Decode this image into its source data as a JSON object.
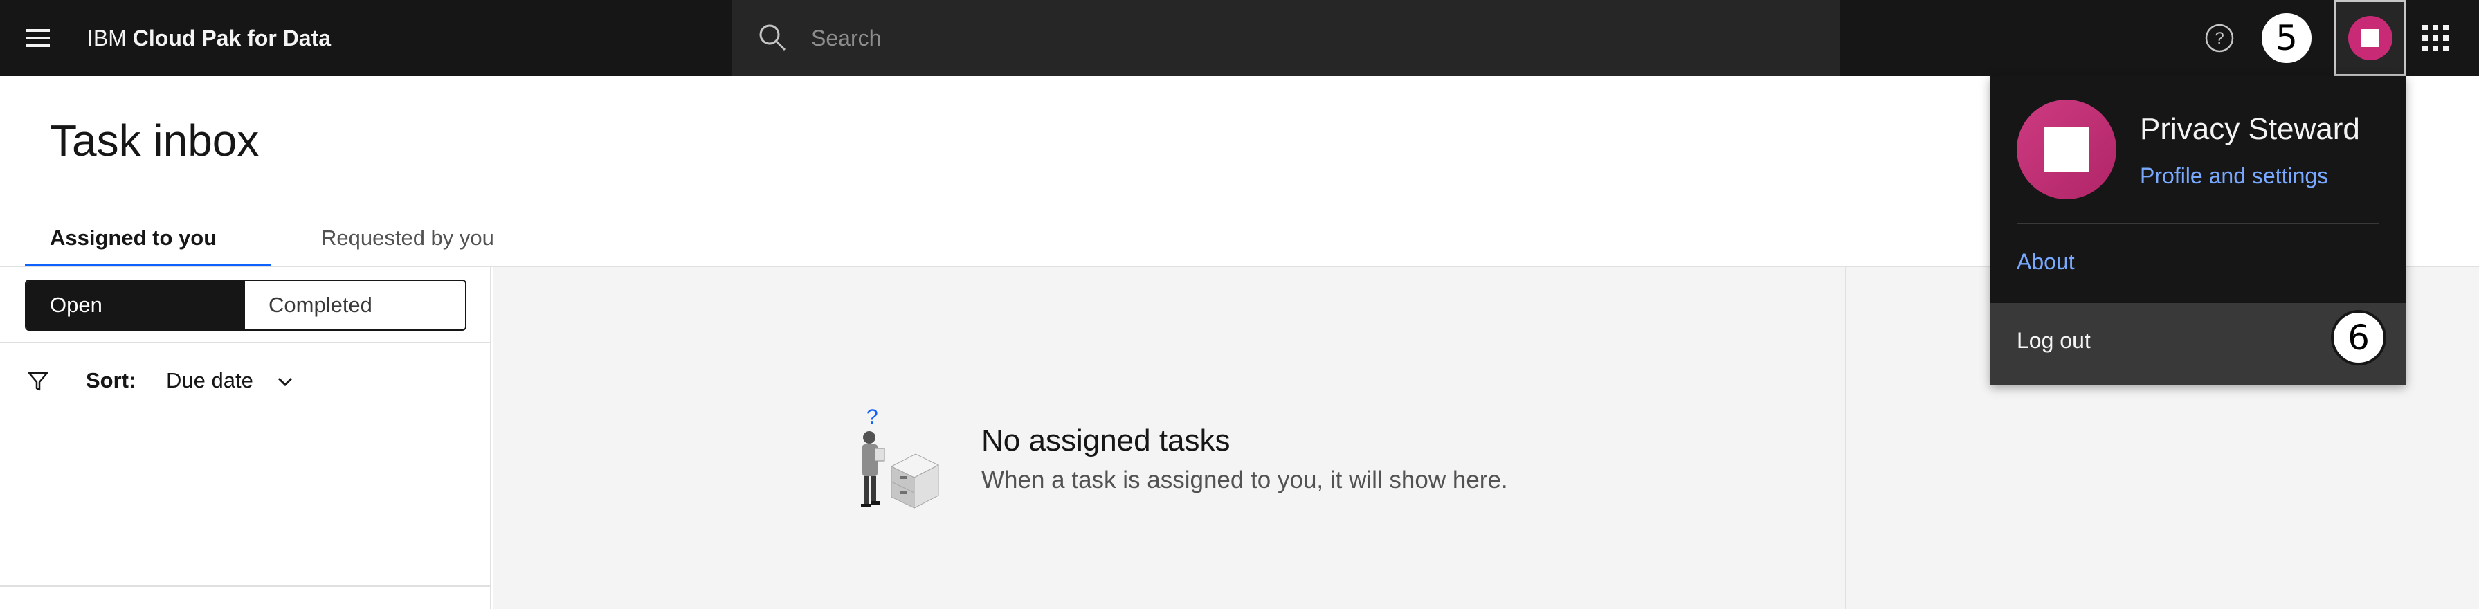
{
  "header": {
    "brand_prefix": "IBM",
    "brand_name": "Cloud Pak for Data",
    "search_placeholder": "Search",
    "callout_5": "5"
  },
  "page": {
    "title": "Task inbox",
    "tabs": [
      {
        "label": "Assigned to you",
        "selected": true
      },
      {
        "label": "Requested by you",
        "selected": false
      }
    ]
  },
  "filter": {
    "toggle": [
      {
        "label": "Open",
        "selected": true
      },
      {
        "label": "Completed",
        "selected": false
      }
    ],
    "sort_label": "Sort:",
    "sort_value": "Due date"
  },
  "empty_state": {
    "title": "No assigned tasks",
    "body": "When a task is assigned to you, it will show here."
  },
  "user_menu": {
    "name": "Privacy Steward",
    "profile_link": "Profile and settings",
    "about_link": "About",
    "logout_label": "Log out",
    "callout_6": "6",
    "avatar_color": "#c92a76"
  },
  "colors": {
    "header_bg": "#161616",
    "link": "#78a9ff",
    "tab_accent": "#0f62fe"
  }
}
